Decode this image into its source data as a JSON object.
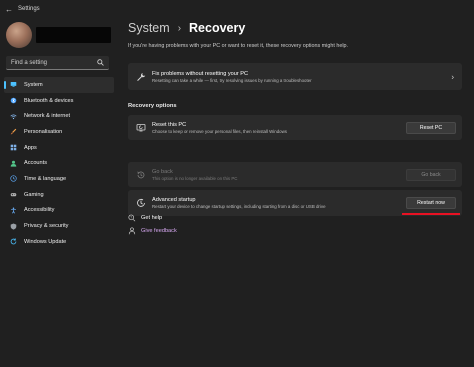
{
  "window": {
    "title": "Settings",
    "back_glyph": "←"
  },
  "sidebar": {
    "search_placeholder": "Find a setting",
    "items": [
      {
        "label": "System",
        "icon": "monitor-icon",
        "color": "#4cc2ff",
        "active": true
      },
      {
        "label": "Bluetooth & devices",
        "icon": "bluetooth-icon",
        "color": "#4aa3ff"
      },
      {
        "label": "Network & internet",
        "icon": "wifi-icon",
        "color": "#8fc4ff"
      },
      {
        "label": "Personalisation",
        "icon": "brush-icon",
        "color": "#f0a14b"
      },
      {
        "label": "Apps",
        "icon": "apps-icon",
        "color": "#7fb0e6"
      },
      {
        "label": "Accounts",
        "icon": "person-icon",
        "color": "#53c489"
      },
      {
        "label": "Time & language",
        "icon": "globe-clock-icon",
        "color": "#5aa0e8"
      },
      {
        "label": "Gaming",
        "icon": "gamepad-icon",
        "color": "#b4b4b4"
      },
      {
        "label": "Accessibility",
        "icon": "accessibility-icon",
        "color": "#6cb3ff"
      },
      {
        "label": "Privacy & security",
        "icon": "shield-icon",
        "color": "#9aa0a6"
      },
      {
        "label": "Windows Update",
        "icon": "update-icon",
        "color": "#4cc2ff"
      }
    ]
  },
  "main": {
    "breadcrumb_parent": "System",
    "breadcrumb_chevron": "›",
    "breadcrumb_current": "Recovery",
    "intro": "If you're having problems with your PC or want to reset it, these recovery options might help.",
    "fix_card": {
      "title": "Fix problems without resetting your PC",
      "desc": "Resetting can take a while — first, try resolving issues by running a troubleshooter",
      "chevron": "›"
    },
    "section_title": "Recovery options",
    "options": [
      {
        "title": "Reset this PC",
        "desc": "Choose to keep or remove your personal files, then reinstall Windows",
        "button": "Reset PC",
        "enabled": true
      },
      {
        "title": "Go back",
        "desc": "This option is no longer available on this PC",
        "button": "Go back",
        "enabled": false
      },
      {
        "title": "Advanced startup",
        "desc": "Restart your device to change startup settings, including starting from a disc or USB drive",
        "button": "Restart now",
        "enabled": true
      }
    ],
    "links": {
      "help": "Get help",
      "feedback": "Give feedback"
    }
  },
  "colors": {
    "accent": "#4cc2ff",
    "highlight_underline": "#e81123",
    "link_feedback": "#d6a8f0"
  }
}
